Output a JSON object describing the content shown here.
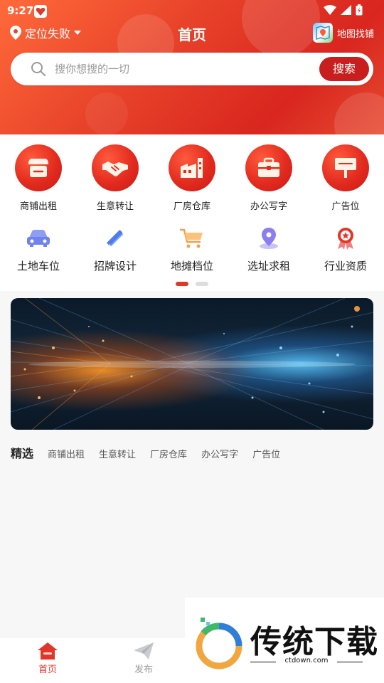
{
  "status_bar": {
    "time": "9:27"
  },
  "header": {
    "location": "定位失败",
    "title": "首页",
    "map_find": "地图找铺"
  },
  "search": {
    "placeholder": "搜你想搜的一切",
    "button": "搜索"
  },
  "categories_primary": [
    {
      "label": "商铺出租",
      "icon": "storefront-icon"
    },
    {
      "label": "生意转让",
      "icon": "handshake-icon"
    },
    {
      "label": "厂房仓库",
      "icon": "factory-icon"
    },
    {
      "label": "办公写字",
      "icon": "briefcase-icon"
    },
    {
      "label": "广告位",
      "icon": "billboard-icon"
    }
  ],
  "categories_secondary": [
    {
      "label": "土地车位",
      "icon": "car-icon"
    },
    {
      "label": "招牌设计",
      "icon": "pencil-ruler-icon"
    },
    {
      "label": "地摊档位",
      "icon": "cart-icon"
    },
    {
      "label": "选址求租",
      "icon": "map-pin-icon"
    },
    {
      "label": "行业资质",
      "icon": "award-badge-icon"
    }
  ],
  "pager": {
    "pages": 2,
    "active": 0
  },
  "featured_tabs": {
    "main": "精选",
    "items": [
      "商铺出租",
      "生意转让",
      "厂房仓库",
      "办公写字",
      "广告位"
    ]
  },
  "bottom_nav": [
    {
      "label": "首页",
      "icon": "home-icon",
      "active": true
    },
    {
      "label": "发布",
      "icon": "paper-plane-icon",
      "active": false
    }
  ],
  "watermark": {
    "text": "传统下载",
    "sub": "ctdown.com"
  },
  "colors": {
    "primary": "#e0372a",
    "search_button": "#c81e1e"
  }
}
